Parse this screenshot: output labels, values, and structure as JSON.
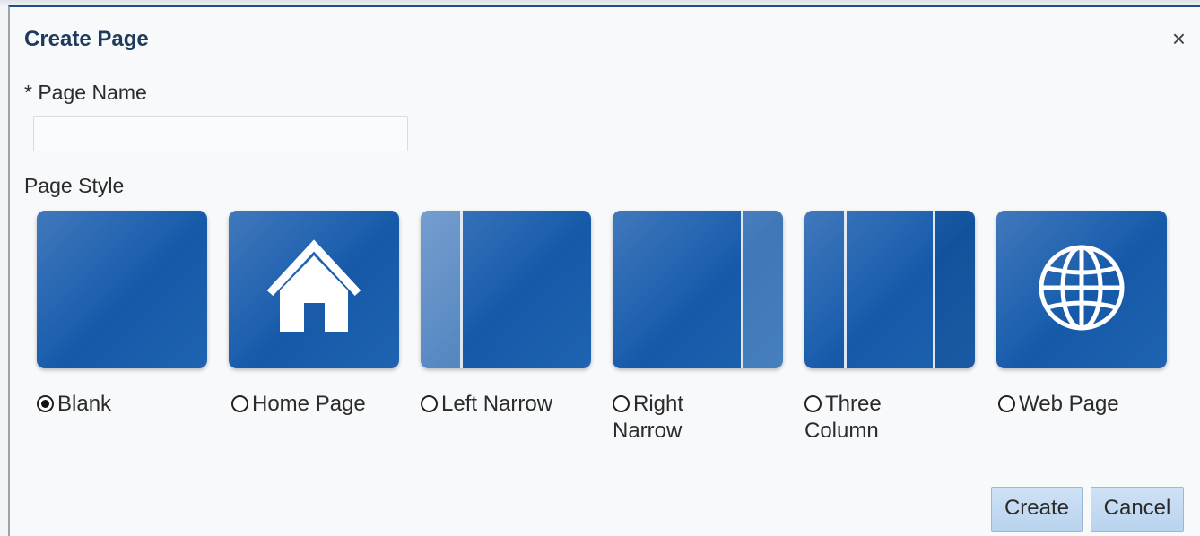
{
  "dialog": {
    "title": "Create Page",
    "close_symbol": "×"
  },
  "form": {
    "page_name_label": "* Page Name",
    "page_name_value": "",
    "page_style_label": "Page Style"
  },
  "styles": [
    {
      "icon": "blank-icon",
      "line1": "Blank",
      "line2": "",
      "selected": true
    },
    {
      "icon": "home-icon",
      "line1": "Home Page",
      "line2": "",
      "selected": false
    },
    {
      "icon": "left-narrow-layout-icon",
      "line1": "Left Narrow",
      "line2": "",
      "selected": false
    },
    {
      "icon": "right-narrow-layout-icon",
      "line1": "Right",
      "line2": "Narrow",
      "selected": false
    },
    {
      "icon": "three-column-layout-icon",
      "line1": "Three",
      "line2": "Column",
      "selected": false
    },
    {
      "icon": "globe-icon",
      "line1": "Web Page",
      "line2": "",
      "selected": false
    }
  ],
  "buttons": {
    "create": "Create",
    "cancel": "Cancel"
  },
  "colors": {
    "tile_blue": "#1d60ae",
    "title_color": "#1d3b5c",
    "button_blue": "#c3daf1"
  }
}
